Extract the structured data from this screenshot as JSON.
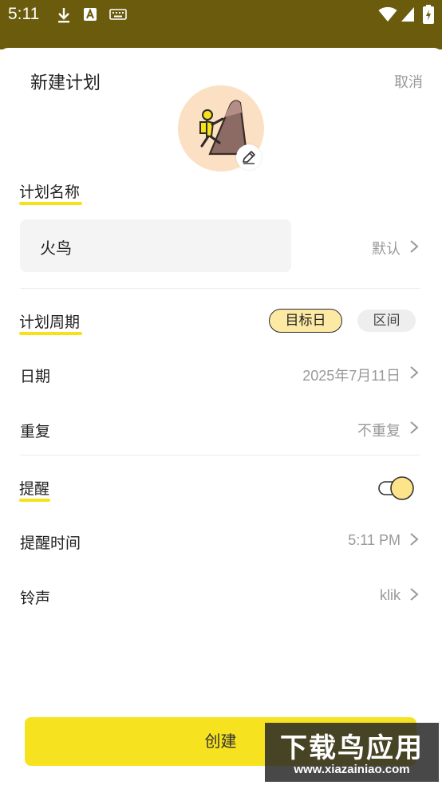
{
  "status_bar": {
    "time": "5:11",
    "icons": [
      "download-icon",
      "a-notification-icon",
      "keyboard-icon",
      "wifi-icon",
      "signal-icon",
      "battery-icon"
    ]
  },
  "header": {
    "title": "新建计划",
    "cancel_label": "取消"
  },
  "avatar": {
    "icon": "climber-icon",
    "edit_icon": "edit-pencil-icon"
  },
  "plan_name": {
    "section_label": "计划名称",
    "value": "火鸟",
    "default_label": "默认"
  },
  "plan_cycle": {
    "section_label": "计划周期",
    "options": [
      "目标日",
      "区间"
    ],
    "selected": "目标日"
  },
  "date": {
    "label": "日期",
    "value": "2025年7月11日"
  },
  "repeat": {
    "label": "重复",
    "value": "不重复"
  },
  "reminder": {
    "section_label": "提醒",
    "enabled": true
  },
  "reminder_time": {
    "label": "提醒时间",
    "value": "5:11 PM"
  },
  "ringtone": {
    "label": "铃声",
    "value": "klik"
  },
  "create_button": {
    "label": "创建"
  },
  "watermark": {
    "main": "下载鸟应用",
    "sub": "www.xiazainiao.com"
  },
  "colors": {
    "accent": "#f6e21e",
    "status_bar": "#6a5c0c",
    "avatar_bg": "#fce0c3",
    "pill_active": "#fbe9a4"
  }
}
